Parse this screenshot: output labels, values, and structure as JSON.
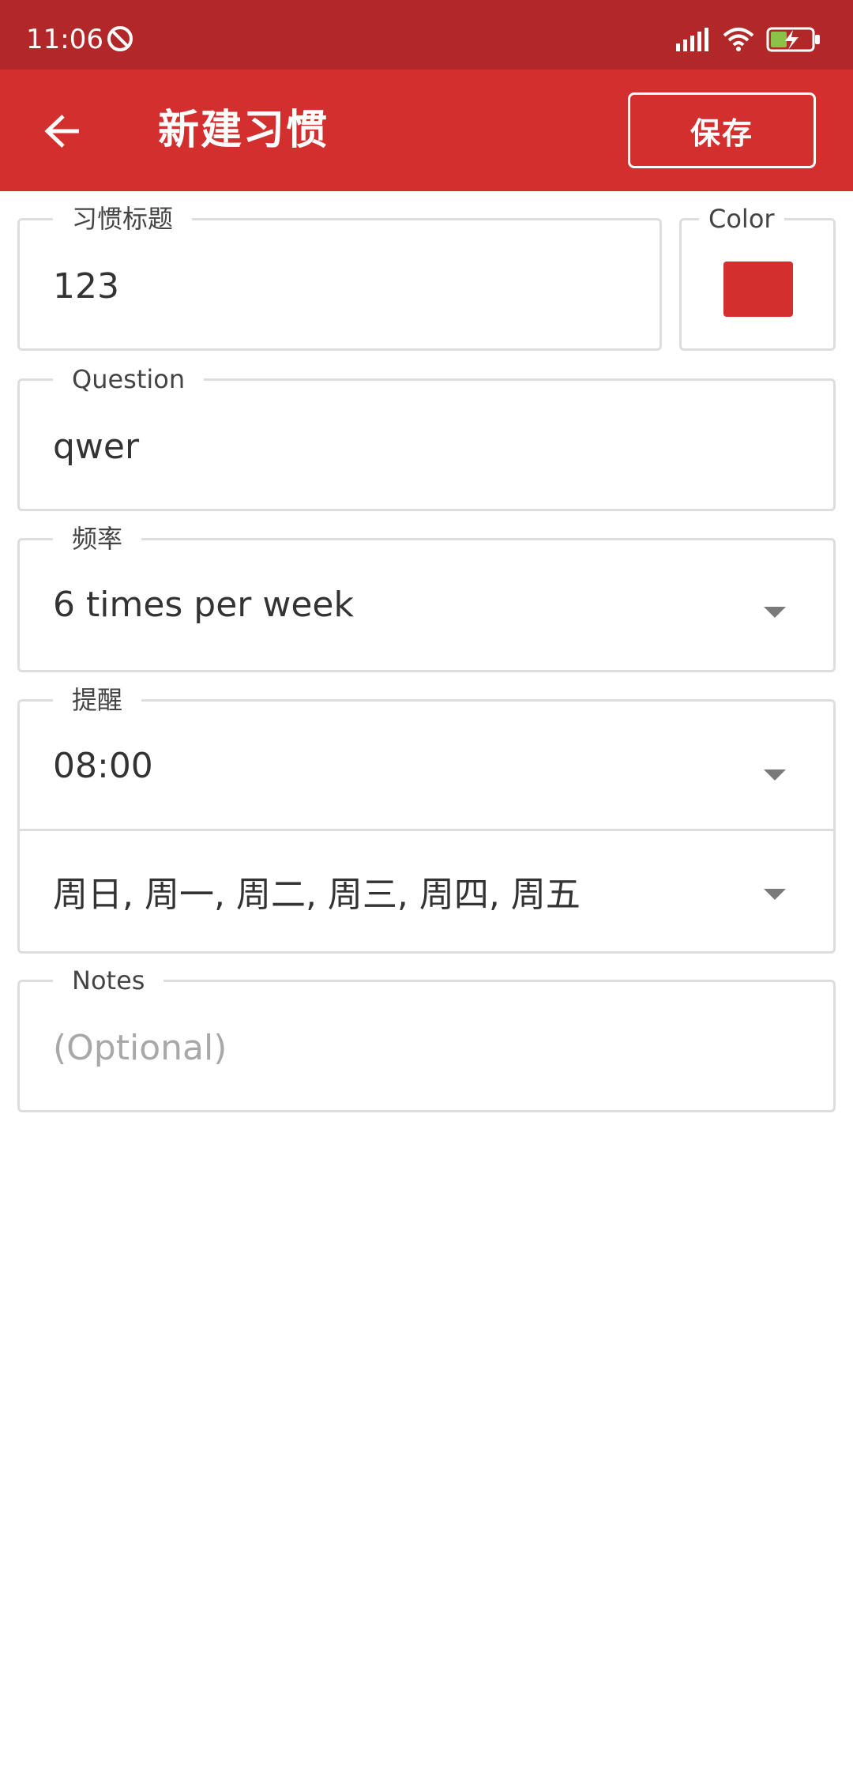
{
  "status_bar": {
    "time": "11:06",
    "icons": [
      "do-not-disturb-icon",
      "signal-icon",
      "wifi-icon",
      "battery-charging-icon"
    ]
  },
  "app_bar": {
    "back_icon": "arrow-left-icon",
    "title": "新建习惯",
    "save_label": "保存"
  },
  "form": {
    "title_field": {
      "label": "习惯标题",
      "value": "123"
    },
    "color_field": {
      "label": "Color",
      "value": "#d32f2f"
    },
    "question_field": {
      "label": "Question",
      "value": "qwer"
    },
    "frequency_field": {
      "label": "频率",
      "value": "6 times per week"
    },
    "reminder_field": {
      "label": "提醒",
      "time": "08:00",
      "days": "周日, 周一, 周二, 周三, 周四, 周五"
    },
    "notes_field": {
      "label": "Notes",
      "placeholder": "(Optional)"
    }
  },
  "colors": {
    "status_bar": "#b22828",
    "app_bar": "#d32f2f",
    "accent": "#d32f2f"
  }
}
